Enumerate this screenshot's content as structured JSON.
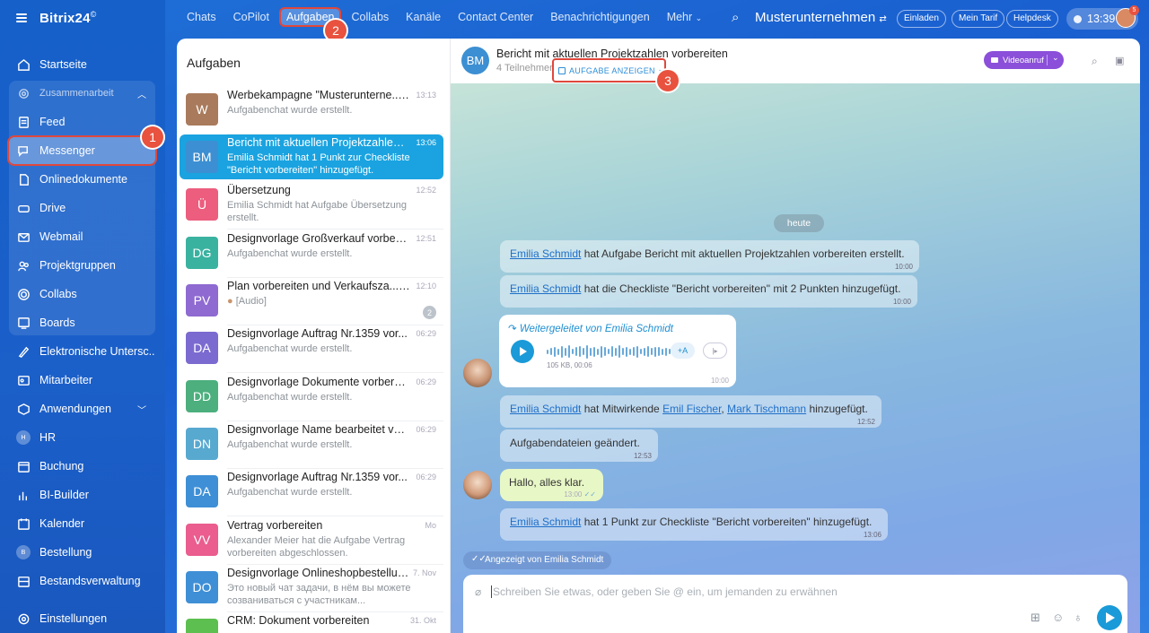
{
  "sidebar": {
    "logo": "Bitrix24",
    "logo_mark": "©",
    "items": [
      {
        "label": "Startseite",
        "icon": "home-icon"
      },
      {
        "label": "Zusammenarbeit",
        "icon": "collab-icon"
      },
      {
        "label": "Feed",
        "icon": "feed-icon"
      },
      {
        "label": "Messenger",
        "icon": "chat-icon"
      },
      {
        "label": "Onlinedokumente",
        "icon": "document-icon"
      },
      {
        "label": "Drive",
        "icon": "drive-icon"
      },
      {
        "label": "Webmail",
        "icon": "mail-icon"
      },
      {
        "label": "Projektgruppen",
        "icon": "group-icon"
      },
      {
        "label": "Collabs",
        "icon": "collabs-icon"
      },
      {
        "label": "Boards",
        "icon": "board-icon"
      },
      {
        "label": "Elektronische Untersc...",
        "icon": "signature-icon"
      },
      {
        "label": "Mitarbeiter",
        "icon": "employees-icon"
      },
      {
        "label": "Anwendungen",
        "icon": "apps-icon"
      },
      {
        "label": "HR",
        "icon": "hr-icon",
        "short": "H"
      },
      {
        "label": "Buchung",
        "icon": "booking-icon"
      },
      {
        "label": "BI-Builder",
        "icon": "chart-icon"
      },
      {
        "label": "Kalender",
        "icon": "calendar-icon"
      },
      {
        "label": "Bestellung",
        "icon": "order-icon",
        "short": "B"
      },
      {
        "label": "Bestandsverwaltung",
        "icon": "inventory-icon"
      },
      {
        "label": "Einstellungen",
        "icon": "settings-icon"
      }
    ]
  },
  "annotations": [
    "1",
    "2",
    "3"
  ],
  "topbar": {
    "tabs": [
      "Chats",
      "CoPilot",
      "Aufgaben",
      "Collabs",
      "Kanäle",
      "Contact Center",
      "Benachrichtigungen",
      "Mehr"
    ],
    "company": "Musterunternehmen",
    "buttons": [
      "Einladen",
      "Mein Tarif",
      "Helpdesk"
    ],
    "clock": "13:39",
    "avatar_badge": "5"
  },
  "list": {
    "title": "Aufgaben",
    "chats": [
      {
        "initials": "W",
        "color": "#a97b5c",
        "name": "Werbekampagne \"Musterunterne...",
        "time": "13:13",
        "preview": "Aufgabenchat wurde erstellt.",
        "muted": true
      },
      {
        "initials": "BM",
        "color": "#3c8fd2",
        "name": "Bericht mit aktuellen Projektzahlen ...",
        "time": "13:06",
        "preview": "Emilia Schmidt hat 1 Punkt zur Checkliste \"Bericht vorbereiten\" hinzugefügt.",
        "selected": true
      },
      {
        "initials": "Ü",
        "color": "#ec5d7e",
        "name": "Übersetzung",
        "time": "12:52",
        "preview": "Emilia Schmidt hat Aufgabe Übersetzung erstellt."
      },
      {
        "initials": "DG",
        "color": "#3ab2a0",
        "name": "Designvorlage Großverkauf vorberei...",
        "time": "12:51",
        "preview": "Aufgabenchat wurde erstellt."
      },
      {
        "initials": "PV",
        "color": "#8e6ad1",
        "name": "Plan vorbereiten und Verkaufsza...",
        "time": "12:10",
        "preview": "[Audio]",
        "muted": true,
        "count": "2"
      },
      {
        "initials": "DA",
        "color": "#7b6bd0",
        "name": "Designvorlage Auftrag Nr.1359 vor...",
        "time": "06:29",
        "preview": "Aufgabenchat wurde erstellt."
      },
      {
        "initials": "DD",
        "color": "#4caf7d",
        "name": "Designvorlage Dokumente vorberei...",
        "time": "06:29",
        "preview": "Aufgabenchat wurde erstellt."
      },
      {
        "initials": "DN",
        "color": "#58a9d0",
        "name": "Designvorlage Name bearbeitet vor...",
        "time": "06:29",
        "preview": "Aufgabenchat wurde erstellt."
      },
      {
        "initials": "DA",
        "color": "#3e8fd6",
        "name": "Designvorlage Auftrag Nr.1359 vor...",
        "time": "06:29",
        "preview": "Aufgabenchat wurde erstellt."
      },
      {
        "initials": "VV",
        "color": "#ea5d8e",
        "name": "Vertrag vorbereiten",
        "time": "Mo",
        "preview": "Alexander Meier hat die Aufgabe Vertrag vorbereiten abgeschlossen."
      },
      {
        "initials": "DO",
        "color": "#3e8fd6",
        "name": "Designvorlage Onlineshopbestellun...",
        "time": "7. Nov",
        "preview": "Это новый чат задачи, в нём вы можете созваниваться с участникам..."
      },
      {
        "initials": "",
        "color": "#5cbf4f",
        "name": "CRM: Dokument vorbereiten",
        "time": "31. Okt",
        "preview": ""
      }
    ]
  },
  "chat": {
    "avatar": "BM",
    "title": "Bericht mit aktuellen Projektzahlen vorbereiten",
    "subtitle": "4 Teilnehmer",
    "task_link": "AUFGABE ANZEIGEN",
    "video_button": "Videoanruf",
    "date_divider": "heute",
    "messages": {
      "m1_user": "Emilia Schmidt",
      "m1_text": " hat Aufgabe Bericht mit aktuellen Projektzahlen vorbereiten erstellt.",
      "m1_time": "10:00",
      "m2_user": "Emilia Schmidt",
      "m2_text": " hat die Checkliste \"Bericht vorbereiten\" mit 2 Punkten hinzugefügt.",
      "m2_time": "10:00",
      "fw_label": "Weitergeleitet von Emilia Schmidt",
      "audio_meta": "105 KB, 00:06",
      "audio_translate": "+A",
      "audio_time": "10:00",
      "m3_user": "Emilia Schmidt",
      "m3_mid": " hat Mitwirkende ",
      "m3_u2": "Emil Fischer",
      "m3_sep": ", ",
      "m3_u3": "Mark Tischmann",
      "m3_end": " hinzugefügt.",
      "m3_time": "12:52",
      "m4_text": "Aufgabendateien geändert.",
      "m4_time": "12:53",
      "m5_text": "Hallo, alles klar.",
      "m5_time": "13:00",
      "m6_user": "Emilia Schmidt",
      "m6_text": " hat 1 Punkt zur Checkliste \"Bericht vorbereiten\" hinzugefügt.",
      "m6_time": "13:06"
    },
    "seen_by": "Angezeigt von Emilia Schmidt",
    "composer_placeholder": "Schreiben Sie etwas, oder geben Sie @ ein, um jemanden zu erwähnen"
  }
}
